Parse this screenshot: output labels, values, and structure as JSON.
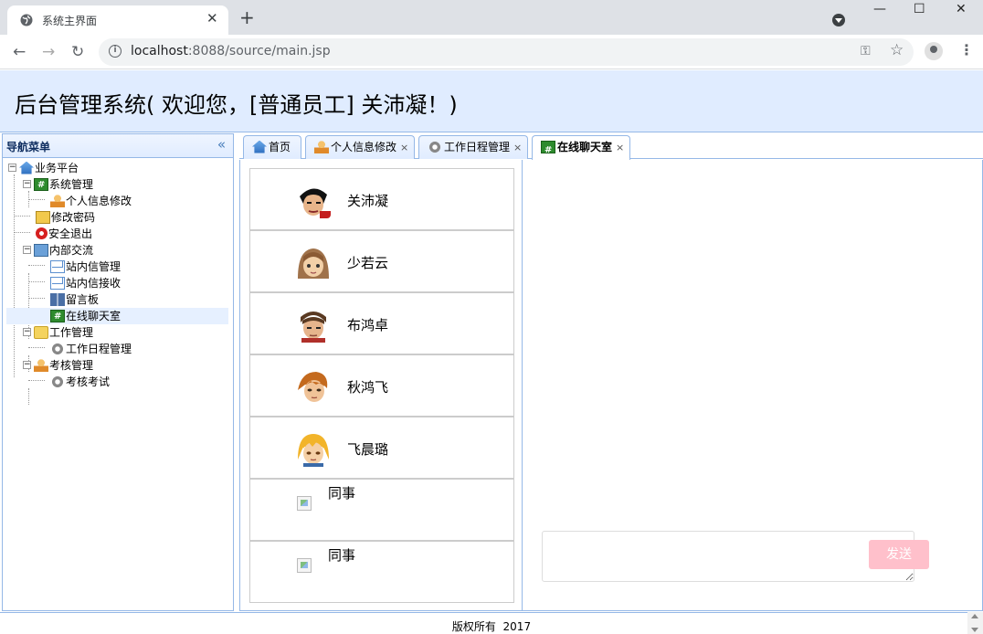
{
  "browser": {
    "tab_title": "系统主界面",
    "tab_close": "✕",
    "new_tab": "+",
    "url_host": "localhost",
    "url_rest": ":8088/source/main.jsp",
    "win_min": "—",
    "win_max": "☐",
    "win_close": "✕",
    "back": "←",
    "forward": "→",
    "reload": "↻",
    "key_glyph": "⚿",
    "star_glyph": "☆",
    "menu_glyph": "⋮",
    "info_glyph": "i"
  },
  "header": {
    "title": "后台管理系统( 欢迎您，[普通员工] 关沛凝！)"
  },
  "nav": {
    "title": "导航菜单",
    "collapse": "«",
    "items": [
      {
        "label": "业务平台"
      },
      {
        "label": "系统管理"
      },
      {
        "label": "个人信息修改"
      },
      {
        "label": "修改密码"
      },
      {
        "label": "安全退出"
      },
      {
        "label": "内部交流"
      },
      {
        "label": "站内信管理"
      },
      {
        "label": "站内信接收"
      },
      {
        "label": "留言板"
      },
      {
        "label": "在线聊天室"
      },
      {
        "label": "工作管理"
      },
      {
        "label": "工作日程管理"
      },
      {
        "label": "考核管理"
      },
      {
        "label": "考核考试"
      }
    ],
    "toggle_open": "−"
  },
  "tabs": [
    {
      "label": "首页",
      "closable": false
    },
    {
      "label": "个人信息修改",
      "closable": true
    },
    {
      "label": "工作日程管理",
      "closable": true
    },
    {
      "label": "在线聊天室",
      "closable": true
    }
  ],
  "tab_close": "×",
  "chat": {
    "users": [
      {
        "name": "关沛凝"
      },
      {
        "name": "少若云"
      },
      {
        "name": "布鸿卓"
      },
      {
        "name": "秋鸿飞"
      },
      {
        "name": "飞晨璐"
      },
      {
        "name": "同事"
      },
      {
        "name": "同事"
      }
    ],
    "send_label": "发送",
    "send_color": "#ffc0cb"
  },
  "footer": {
    "copyright": "版权所有  2017"
  },
  "colors": {
    "header_bg": "#e0ecff",
    "border": "#95b8e7"
  }
}
